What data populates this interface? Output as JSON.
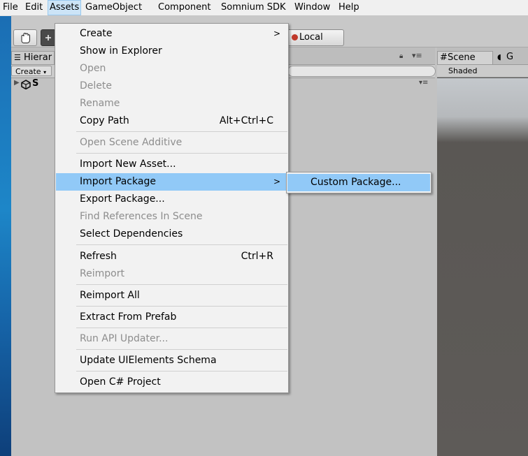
{
  "menubar": {
    "items": [
      "File",
      "Edit",
      "Assets",
      "GameObject",
      "Component",
      "Somnium SDK",
      "Window",
      "Help"
    ],
    "active": "Assets"
  },
  "toolbar": {
    "local_label": "Local"
  },
  "hierarchy": {
    "tab_label": "Hierar",
    "create_label": "Create",
    "scene_initial": "S"
  },
  "scene": {
    "tab_label": "Scene",
    "game_tab_label": "G",
    "shading_label": "Shaded"
  },
  "assets_menu": {
    "items": [
      {
        "label": "Create",
        "shortcut": "",
        "submenu": true,
        "enabled": true
      },
      {
        "label": "Show in Explorer",
        "shortcut": "",
        "submenu": false,
        "enabled": true
      },
      {
        "label": "Open",
        "shortcut": "",
        "submenu": false,
        "enabled": false
      },
      {
        "label": "Delete",
        "shortcut": "",
        "submenu": false,
        "enabled": false
      },
      {
        "label": "Rename",
        "shortcut": "",
        "submenu": false,
        "enabled": false
      },
      {
        "label": "Copy Path",
        "shortcut": "Alt+Ctrl+C",
        "submenu": false,
        "enabled": true
      },
      {
        "label": "Open Scene Additive",
        "shortcut": "",
        "submenu": false,
        "enabled": false
      },
      {
        "label": "Import New Asset...",
        "shortcut": "",
        "submenu": false,
        "enabled": true
      },
      {
        "label": "Import Package",
        "shortcut": "",
        "submenu": true,
        "enabled": true,
        "highlighted": true
      },
      {
        "label": "Export Package...",
        "shortcut": "",
        "submenu": false,
        "enabled": true
      },
      {
        "label": "Find References In Scene",
        "shortcut": "",
        "submenu": false,
        "enabled": false
      },
      {
        "label": "Select Dependencies",
        "shortcut": "",
        "submenu": false,
        "enabled": true
      },
      {
        "label": "Refresh",
        "shortcut": "Ctrl+R",
        "submenu": false,
        "enabled": true
      },
      {
        "label": "Reimport",
        "shortcut": "",
        "submenu": false,
        "enabled": false
      },
      {
        "label": "Reimport All",
        "shortcut": "",
        "submenu": false,
        "enabled": true
      },
      {
        "label": "Extract From Prefab",
        "shortcut": "",
        "submenu": false,
        "enabled": true
      },
      {
        "label": "Run API Updater...",
        "shortcut": "",
        "submenu": false,
        "enabled": false
      },
      {
        "label": "Update UIElements Schema",
        "shortcut": "",
        "submenu": false,
        "enabled": true
      },
      {
        "label": "Open C# Project",
        "shortcut": "",
        "submenu": false,
        "enabled": true
      }
    ]
  },
  "import_package_submenu": {
    "items": [
      {
        "label": "Custom Package...",
        "highlighted": true
      }
    ]
  },
  "colors": {
    "menu_highlight": "#91c9f7",
    "menubar_active": "#cce4f7",
    "panel_bg": "#c2c2c2",
    "menu_bg": "#f2f2f2",
    "disabled_text": "#8d8d8d"
  }
}
